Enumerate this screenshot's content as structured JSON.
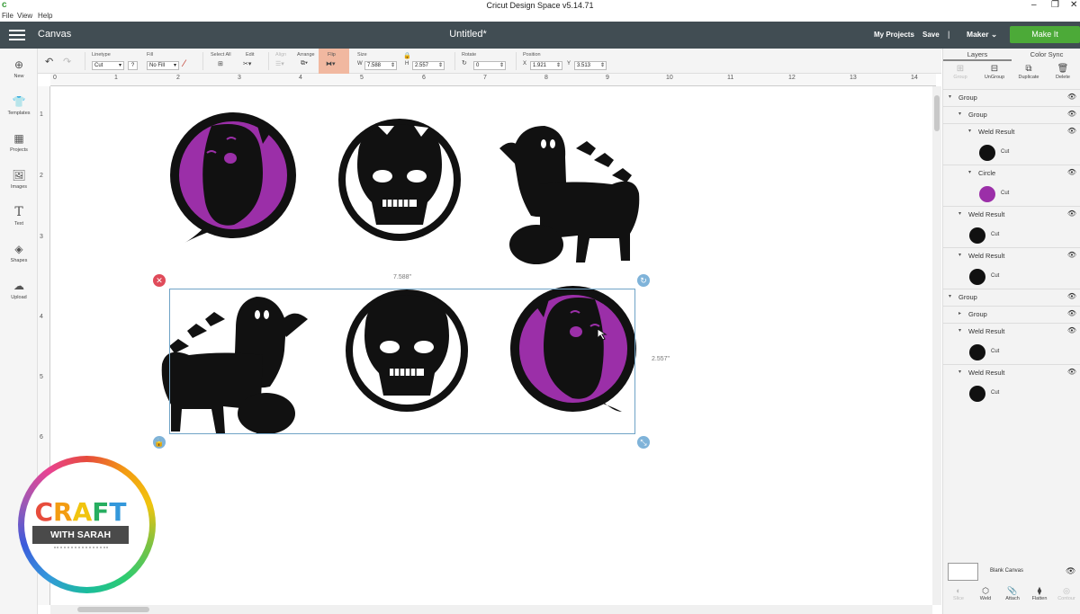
{
  "os": {
    "window_title": "Cricut Design Space  v5.14.71",
    "app_icon_glyph": "c",
    "controls": [
      "–",
      "❐",
      "✕"
    ]
  },
  "menu": [
    "File",
    "View",
    "Help"
  ],
  "header": {
    "canvas_label": "Canvas",
    "document_title": "Untitled*",
    "my_projects": "My Projects",
    "save": "Save",
    "separator": "|",
    "machine": "Maker",
    "make_it": "Make It"
  },
  "toolbar": {
    "linetype_label": "Linetype",
    "linetype_value": "Cut",
    "linetype_help": "?",
    "fill_label": "Fill",
    "fill_value": "No Fill",
    "select_all_label": "Select All",
    "edit_label": "Edit",
    "align_label": "Align",
    "arrange_label": "Arrange",
    "flip_label": "Flip",
    "size_label": "Size",
    "w_label": "W",
    "w_value": "7.588",
    "h_label": "H",
    "h_value": "2.557",
    "rotate_label": "Rotate",
    "rotate_value": "0",
    "position_label": "Position",
    "x_label": "X",
    "x_value": "1.921",
    "y_label": "Y",
    "y_value": "3.513"
  },
  "left_nav": [
    {
      "label": "New",
      "icon": "plus-circle-icon"
    },
    {
      "label": "Templates",
      "icon": "tshirt-icon"
    },
    {
      "label": "Projects",
      "icon": "projects-icon"
    },
    {
      "label": "Images",
      "icon": "image-icon"
    },
    {
      "label": "Text",
      "icon": "text-icon"
    },
    {
      "label": "Shapes",
      "icon": "shapes-icon"
    },
    {
      "label": "Upload",
      "icon": "upload-cloud-icon"
    }
  ],
  "rulers": {
    "h": [
      "0",
      "1",
      "2",
      "3",
      "4",
      "5",
      "6",
      "7",
      "8",
      "9",
      "10",
      "11",
      "12",
      "13",
      "14"
    ],
    "v": [
      "1",
      "2",
      "3",
      "4",
      "5",
      "6"
    ]
  },
  "selection": {
    "width_label": "7.588\"",
    "height_label": "2.557\""
  },
  "right_panel": {
    "tabs": [
      "Layers",
      "Color Sync"
    ],
    "tools": [
      "Group",
      "UnGroup",
      "Duplicate",
      "Delete"
    ],
    "layers": [
      {
        "type": "header",
        "name": "Group",
        "level": 0,
        "expanded": true
      },
      {
        "type": "header",
        "name": "Group",
        "level": 1,
        "expanded": true
      },
      {
        "type": "header",
        "name": "Weld Result",
        "level": 2,
        "expanded": true
      },
      {
        "type": "row",
        "label": "Cut",
        "level": 2,
        "thumb": "#111111"
      },
      {
        "type": "header",
        "name": "Circle",
        "level": 2,
        "expanded": true
      },
      {
        "type": "row",
        "label": "Cut",
        "level": 2,
        "thumb": "#9b2fa8"
      },
      {
        "type": "header",
        "name": "Weld Result",
        "level": 1,
        "expanded": true
      },
      {
        "type": "row",
        "label": "Cut",
        "level": 1,
        "thumb": "#111111"
      },
      {
        "type": "header",
        "name": "Weld Result",
        "level": 1,
        "expanded": true
      },
      {
        "type": "row",
        "label": "Cut",
        "level": 1,
        "thumb": "#111111"
      },
      {
        "type": "header",
        "name": "Group",
        "level": 0,
        "expanded": true
      },
      {
        "type": "header",
        "name": "Group",
        "level": 1,
        "expanded": false
      },
      {
        "type": "header",
        "name": "Weld Result",
        "level": 1,
        "expanded": true
      },
      {
        "type": "row",
        "label": "Cut",
        "level": 1,
        "thumb": "#111111"
      },
      {
        "type": "header",
        "name": "Weld Result",
        "level": 1,
        "expanded": true
      },
      {
        "type": "row",
        "label": "Cut",
        "level": 1,
        "thumb": "#111111"
      }
    ],
    "blank_canvas": "Blank Canvas",
    "bottom_tools": [
      "Slice",
      "Weld",
      "Attach",
      "Flatten",
      "Contour"
    ]
  },
  "logo": {
    "word": "CRAFT",
    "sub": "WITH SARAH",
    "letter_colors": [
      "#e74c3c",
      "#f39c12",
      "#f1c40f",
      "#27ae60",
      "#3498db"
    ]
  },
  "colors": {
    "header_bg": "#414d53",
    "make_it": "#4caa38",
    "flip_highlight": "#f1b8a0",
    "purple": "#9b2fa8",
    "selection": "#6fa3c6",
    "delete_handle": "#e04b5a",
    "handle_blue": "#7fb3d9"
  }
}
